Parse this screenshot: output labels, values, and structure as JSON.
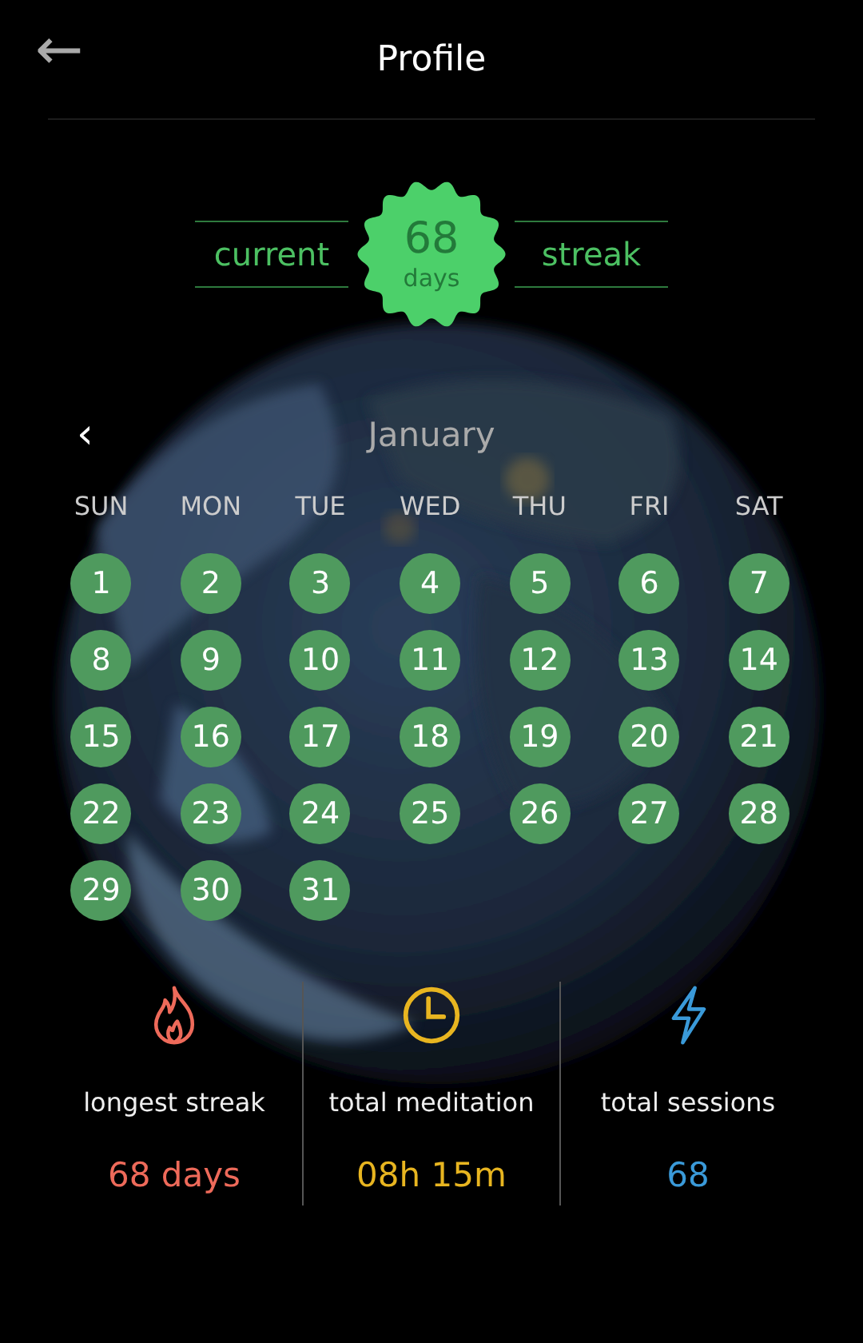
{
  "header": {
    "back": "←",
    "title": "Profile"
  },
  "streak": {
    "left": "current",
    "count": "68",
    "unit": "days",
    "right": "streak"
  },
  "calendar": {
    "prev": "‹",
    "month": "January",
    "weekdays": [
      "SUN",
      "MON",
      "TUE",
      "WED",
      "THU",
      "FRI",
      "SAT"
    ],
    "days": [
      {
        "label": "1",
        "streak": true
      },
      {
        "label": "2",
        "streak": true
      },
      {
        "label": "3",
        "streak": true
      },
      {
        "label": "4",
        "streak": true
      },
      {
        "label": "5",
        "streak": true
      },
      {
        "label": "6",
        "streak": true
      },
      {
        "label": "7",
        "streak": true
      },
      {
        "label": "8",
        "streak": true
      },
      {
        "label": "9",
        "streak": true
      },
      {
        "label": "10",
        "streak": true
      },
      {
        "label": "11",
        "streak": true
      },
      {
        "label": "12",
        "streak": true
      },
      {
        "label": "13",
        "streak": true
      },
      {
        "label": "14",
        "streak": true
      },
      {
        "label": "15",
        "streak": true
      },
      {
        "label": "16",
        "streak": true
      },
      {
        "label": "17",
        "streak": true
      },
      {
        "label": "18",
        "streak": true
      },
      {
        "label": "19",
        "streak": true
      },
      {
        "label": "20",
        "streak": true
      },
      {
        "label": "21",
        "streak": true
      },
      {
        "label": "22",
        "streak": true
      },
      {
        "label": "23",
        "streak": true
      },
      {
        "label": "24",
        "streak": true
      },
      {
        "label": "25",
        "streak": true
      },
      {
        "label": "26",
        "streak": true
      },
      {
        "label": "27",
        "streak": true
      },
      {
        "label": "28",
        "streak": true
      },
      {
        "label": "29",
        "streak": true
      },
      {
        "label": "30",
        "streak": true
      },
      {
        "label": "31",
        "streak": true
      }
    ]
  },
  "stats": [
    {
      "kind": "flame",
      "label": "longest streak",
      "value": "68 days",
      "color": "#ee6a5a"
    },
    {
      "kind": "clock",
      "label": "total meditation",
      "value": "08h 15m",
      "color": "#e8b520"
    },
    {
      "kind": "bolt",
      "label": "total sessions",
      "value": "68",
      "color": "#3a9ad9"
    }
  ]
}
